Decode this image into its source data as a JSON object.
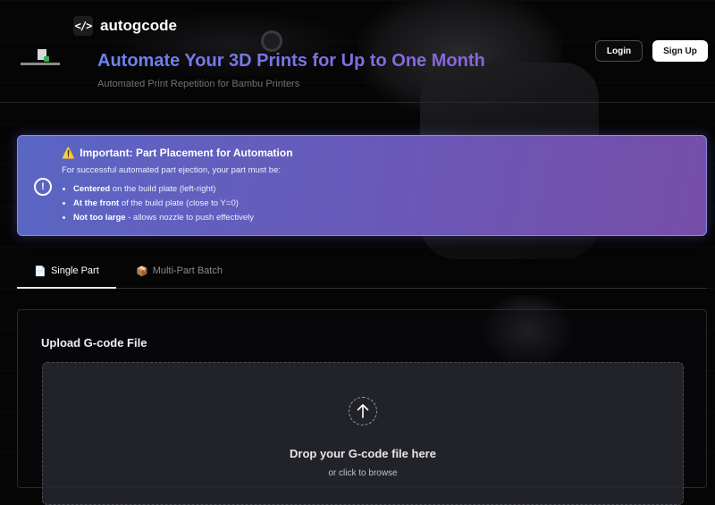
{
  "brand": {
    "mark": "</>",
    "name": "autogcode"
  },
  "hero": {
    "title": "Automate Your 3D Prints for Up to One Month",
    "subtitle": "Automated Print Repetition for Bambu Printers"
  },
  "auth": {
    "login_label": "Login",
    "signup_label": "Sign Up"
  },
  "notice": {
    "icon": "exclamation-circle-icon",
    "warning_glyph": "⚠️",
    "title": "Important: Part Placement for Automation",
    "intro": "For successful automated part ejection, your part must be:",
    "items": [
      {
        "bold": "Centered",
        "text": " on the build plate (left-right)"
      },
      {
        "bold": "At the front",
        "text": " of the build plate (close to Y=0)"
      },
      {
        "bold": "Not too large",
        "text": " - allows nozzle to push effectively"
      }
    ]
  },
  "tabs": [
    {
      "icon": "📄",
      "label": "Single Part",
      "active": true
    },
    {
      "icon": "📦",
      "label": "Multi-Part Batch",
      "active": false
    }
  ],
  "upload": {
    "title": "Upload G-code File",
    "icon": "upload-arrow-icon",
    "drop_title": "Drop your G-code file here",
    "drop_sub": "or click to browse"
  },
  "colors": {
    "accent_start": "#6d83f2",
    "accent_end": "#8b64d8",
    "notice_bg": "#6a58b8",
    "page_bg": "#050506"
  }
}
